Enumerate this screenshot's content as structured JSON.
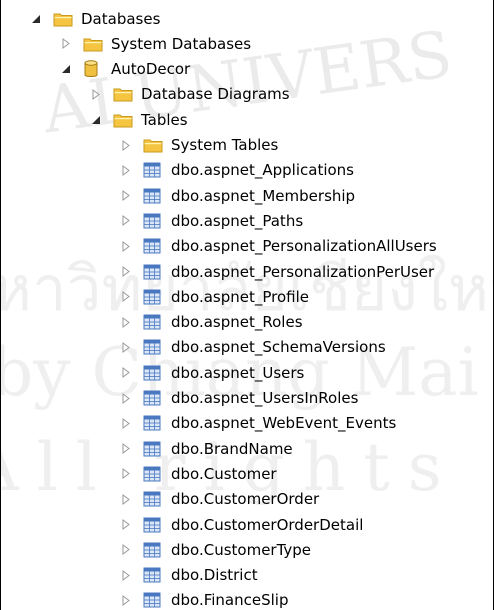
{
  "tree": {
    "nodes": [
      {
        "label": "Databases",
        "icon": "folder-icon",
        "toggle": "expanded",
        "level": 0
      },
      {
        "label": "System Databases",
        "icon": "folder-icon",
        "toggle": "collapsed",
        "level": 1
      },
      {
        "label": "AutoDecor",
        "icon": "database-icon",
        "toggle": "expanded",
        "level": 1
      },
      {
        "label": "Database Diagrams",
        "icon": "folder-icon",
        "toggle": "collapsed",
        "level": 2
      },
      {
        "label": "Tables",
        "icon": "folder-icon",
        "toggle": "expanded",
        "level": 2
      },
      {
        "label": "System Tables",
        "icon": "folder-icon",
        "toggle": "collapsed",
        "level": 3
      },
      {
        "label": "dbo.aspnet_Applications",
        "icon": "table-icon",
        "toggle": "collapsed",
        "level": 3
      },
      {
        "label": "dbo.aspnet_Membership",
        "icon": "table-icon",
        "toggle": "collapsed",
        "level": 3
      },
      {
        "label": "dbo.aspnet_Paths",
        "icon": "table-icon",
        "toggle": "collapsed",
        "level": 3
      },
      {
        "label": "dbo.aspnet_PersonalizationAllUsers",
        "icon": "table-icon",
        "toggle": "collapsed",
        "level": 3
      },
      {
        "label": "dbo.aspnet_PersonalizationPerUser",
        "icon": "table-icon",
        "toggle": "collapsed",
        "level": 3
      },
      {
        "label": "dbo.aspnet_Profile",
        "icon": "table-icon",
        "toggle": "collapsed",
        "level": 3
      },
      {
        "label": "dbo.aspnet_Roles",
        "icon": "table-icon",
        "toggle": "collapsed",
        "level": 3
      },
      {
        "label": "dbo.aspnet_SchemaVersions",
        "icon": "table-icon",
        "toggle": "collapsed",
        "level": 3
      },
      {
        "label": "dbo.aspnet_Users",
        "icon": "table-icon",
        "toggle": "collapsed",
        "level": 3
      },
      {
        "label": "dbo.aspnet_UsersInRoles",
        "icon": "table-icon",
        "toggle": "collapsed",
        "level": 3
      },
      {
        "label": "dbo.aspnet_WebEvent_Events",
        "icon": "table-icon",
        "toggle": "collapsed",
        "level": 3
      },
      {
        "label": "dbo.BrandName",
        "icon": "table-icon",
        "toggle": "collapsed",
        "level": 3
      },
      {
        "label": "dbo.Customer",
        "icon": "table-icon",
        "toggle": "collapsed",
        "level": 3
      },
      {
        "label": "dbo.CustomerOrder",
        "icon": "table-icon",
        "toggle": "collapsed",
        "level": 3
      },
      {
        "label": "dbo.CustomerOrderDetail",
        "icon": "table-icon",
        "toggle": "collapsed",
        "level": 3
      },
      {
        "label": "dbo.CustomerType",
        "icon": "table-icon",
        "toggle": "collapsed",
        "level": 3
      },
      {
        "label": "dbo.District",
        "icon": "table-icon",
        "toggle": "collapsed",
        "level": 3
      },
      {
        "label": "dbo.FinanceSlip",
        "icon": "table-icon",
        "toggle": "collapsed",
        "level": 3
      }
    ]
  },
  "watermark": {
    "line1": "AI UNIVERS",
    "line2": "หาวิทยาลัยเชียงใหม่",
    "line3": "by Chiang Mai University",
    "line4": "All rights reserved",
    "color": "#d8d8d8"
  },
  "colors": {
    "folder": "#f5c542",
    "folder_dark": "#c99a1c",
    "database": "#f0c040",
    "table_header": "#4a78c0",
    "table_body": "#dbe6f7",
    "toggle_expanded": "#2b2b2b",
    "toggle_collapsed": "#9a9a9a"
  }
}
